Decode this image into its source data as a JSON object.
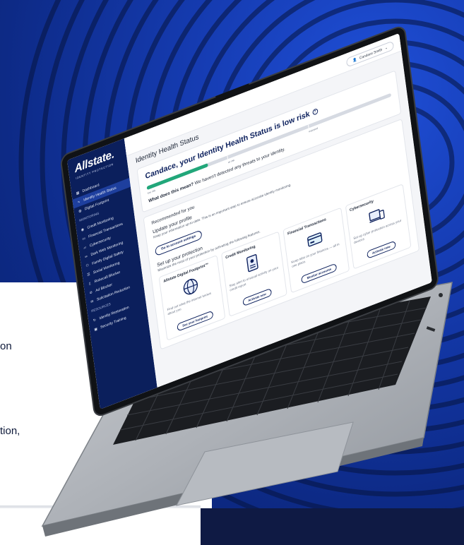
{
  "colors": {
    "brand_navy": "#0b1f5c",
    "accent_green": "#22a77a",
    "hero_blue": "#153bb0"
  },
  "left_copy": {
    "line1": "on",
    "line2": "tion,"
  },
  "app": {
    "brand": "Allstate.",
    "brand_sub": "IDENTITY PROTECTION",
    "user_label": "Candace Smith",
    "sidebar": {
      "items_top": [
        {
          "label": "Dashboard",
          "icon": "grid-icon"
        },
        {
          "label": "Identity Health Status",
          "icon": "pulse-icon",
          "active": true
        },
        {
          "label": "Digital Footprint",
          "icon": "globe-icon"
        }
      ],
      "monitoring_heading": "MONITORING",
      "monitoring_items": [
        {
          "label": "Credit Monitoring",
          "icon": "credit-icon"
        },
        {
          "label": "Financial Transactions",
          "icon": "card-icon"
        },
        {
          "label": "Cybersecurity",
          "icon": "laptop-icon"
        },
        {
          "label": "Dark Web Monitoring",
          "icon": "mask-icon"
        },
        {
          "label": "Family Digital Safety",
          "icon": "family-icon"
        },
        {
          "label": "Social Monitoring",
          "icon": "chat-icon"
        },
        {
          "label": "Robocall Blocker",
          "icon": "phone-icon"
        },
        {
          "label": "Ad Blocker",
          "icon": "block-icon"
        },
        {
          "label": "Solicitation Reduction",
          "icon": "mail-icon"
        }
      ],
      "resources_heading": "RESOURCES",
      "resources_items": [
        {
          "label": "Identity Restoration",
          "icon": "restore-icon"
        },
        {
          "label": "Security Training",
          "icon": "training-icon"
        }
      ]
    },
    "main": {
      "page_title": "Identity Health Status",
      "health": {
        "headline": "Candace, your Identity Health Status is low risk",
        "level": 0.25,
        "label_low": "low risk",
        "label_mid": "at risk",
        "label_high": "exposed",
        "meaning_label": "What does this mean?",
        "meaning_text": "We haven't detected any threats to your identity."
      },
      "recommended": {
        "heading": "Recommended for you",
        "title": "Update your profile",
        "text": "Keep your information up-to-date. This is an important step to ensure accurate identity monitoring.",
        "button": "Go to account settings"
      },
      "protection": {
        "title": "Set up your protection",
        "text": "Maximize the most of your protection by activating the following features.",
        "cards": [
          {
            "title": "Allstate Digital Footprint™",
            "desc": "Find out what the internet knows about you",
            "button": "See your footprint",
            "icon": "globe-icon"
          },
          {
            "title": "Credit Monitoring",
            "desc": "Stay alert to unusual activity on your credit report",
            "button": "Activate now",
            "icon": "document-icon"
          },
          {
            "title": "Financial Transactions",
            "desc": "Keep tabs on your finances — all in one place.",
            "button": "Monitor accounts",
            "icon": "card-icon"
          },
          {
            "title": "Cybersecurity",
            "desc": "Set up cyber protection across your devices",
            "button": "Activate now",
            "icon": "devices-icon"
          }
        ]
      }
    }
  }
}
